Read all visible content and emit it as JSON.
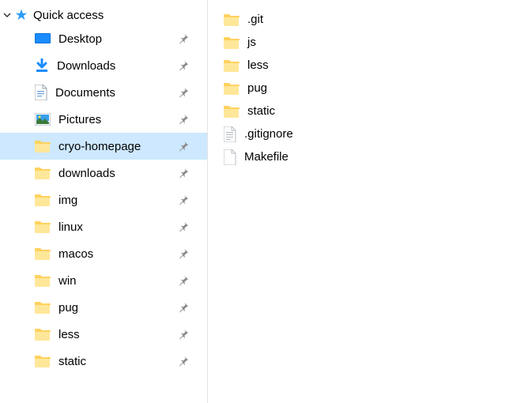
{
  "sidebar": {
    "header_label": "Quick access",
    "items": [
      {
        "label": "Desktop",
        "icon": "desktop",
        "pinned": true,
        "selected": false
      },
      {
        "label": "Downloads",
        "icon": "download",
        "pinned": true,
        "selected": false
      },
      {
        "label": "Documents",
        "icon": "document",
        "pinned": true,
        "selected": false
      },
      {
        "label": "Pictures",
        "icon": "pictures",
        "pinned": true,
        "selected": false
      },
      {
        "label": "cryo-homepage",
        "icon": "folder",
        "pinned": true,
        "selected": true
      },
      {
        "label": "downloads",
        "icon": "folder",
        "pinned": true,
        "selected": false
      },
      {
        "label": "img",
        "icon": "folder",
        "pinned": true,
        "selected": false
      },
      {
        "label": "linux",
        "icon": "folder",
        "pinned": true,
        "selected": false
      },
      {
        "label": "macos",
        "icon": "folder",
        "pinned": true,
        "selected": false
      },
      {
        "label": "win",
        "icon": "folder",
        "pinned": true,
        "selected": false
      },
      {
        "label": "pug",
        "icon": "folder",
        "pinned": true,
        "selected": false
      },
      {
        "label": "less",
        "icon": "folder",
        "pinned": true,
        "selected": false
      },
      {
        "label": "static",
        "icon": "folder",
        "pinned": true,
        "selected": false
      }
    ]
  },
  "content": {
    "items": [
      {
        "label": ".git",
        "icon": "folder"
      },
      {
        "label": "js",
        "icon": "folder"
      },
      {
        "label": "less",
        "icon": "folder"
      },
      {
        "label": "pug",
        "icon": "folder"
      },
      {
        "label": "static",
        "icon": "folder"
      },
      {
        "label": ".gitignore",
        "icon": "textfile"
      },
      {
        "label": "Makefile",
        "icon": "blankfile"
      }
    ]
  }
}
